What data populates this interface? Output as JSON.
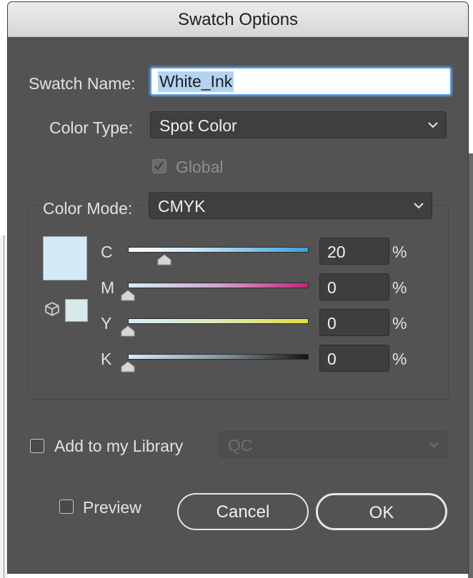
{
  "dialog": {
    "title": "Swatch Options"
  },
  "swatch_name": {
    "label": "Swatch Name:",
    "value": "White_Ink"
  },
  "color_type": {
    "label": "Color Type:",
    "value": "Spot Color"
  },
  "global": {
    "label": "Global",
    "checked": true,
    "disabled": true
  },
  "color_mode": {
    "label": "Color Mode:",
    "value": "CMYK"
  },
  "channels": [
    {
      "label": "C",
      "value": "20",
      "unit": "%",
      "level": 0.2
    },
    {
      "label": "M",
      "value": "0",
      "unit": "%",
      "level": 0
    },
    {
      "label": "Y",
      "value": "0",
      "unit": "%",
      "level": 0
    },
    {
      "label": "K",
      "value": "0",
      "unit": "%",
      "level": 0
    }
  ],
  "library": {
    "label": "Add to my Library",
    "checked": false,
    "select_value": "QC"
  },
  "preview": {
    "label": "Preview",
    "checked": false
  },
  "buttons": {
    "cancel": "Cancel",
    "ok": "OK"
  },
  "colors": {
    "swatch_preview": "#d4e9f8",
    "swatch_gamut": "#d7eae9",
    "focus_ring": "#5a9ee6",
    "panel_bg": "#535353"
  }
}
